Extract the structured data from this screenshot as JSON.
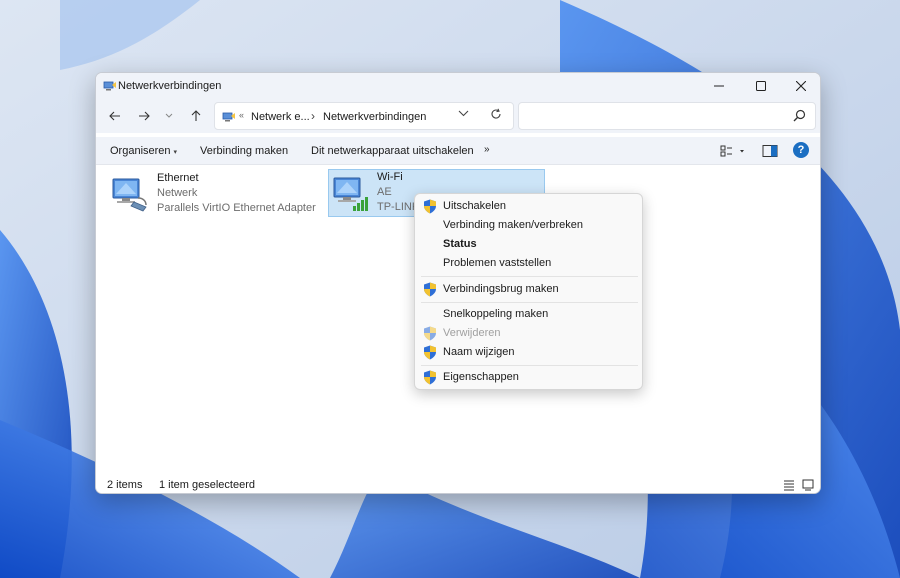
{
  "window": {
    "title": "Netwerkverbindingen"
  },
  "address_bar": {
    "crumbs": [
      "Netwerk e...",
      "Netwerkverbindingen"
    ]
  },
  "search": {
    "placeholder": ""
  },
  "command_bar": {
    "organize": "Organiseren",
    "connect": "Verbinding maken",
    "disable_device": "Dit netwerkapparaat uitschakelen",
    "more": "»"
  },
  "items": [
    {
      "name": "Ethernet",
      "status": "Netwerk",
      "adapter": "Parallels VirtIO Ethernet Adapter",
      "selected": false
    },
    {
      "name": "Wi-Fi",
      "status": "AE",
      "adapter": "TP-LINK",
      "selected": true
    }
  ],
  "status_bar": {
    "count": "2 items",
    "selection": "1 item geselecteerd"
  },
  "context_menu": {
    "items": [
      {
        "label": "Uitschakelen",
        "icon": "shield-icon",
        "bold": false,
        "disabled": false
      },
      {
        "label": "Verbinding maken/verbreken",
        "icon": "",
        "bold": false,
        "disabled": false
      },
      {
        "label": "Status",
        "icon": "",
        "bold": true,
        "disabled": false
      },
      {
        "label": "Problemen vaststellen",
        "icon": "",
        "bold": false,
        "disabled": false
      },
      {
        "label": "Verbindingsbrug maken",
        "icon": "shield-icon",
        "bold": false,
        "disabled": false
      },
      {
        "label": "Snelkoppeling maken",
        "icon": "",
        "bold": false,
        "disabled": false
      },
      {
        "label": "Verwijderen",
        "icon": "shield-icon",
        "bold": false,
        "disabled": true
      },
      {
        "label": "Naam wijzigen",
        "icon": "shield-icon",
        "bold": false,
        "disabled": false
      },
      {
        "label": "Eigenschappen",
        "icon": "shield-icon",
        "bold": false,
        "disabled": false
      }
    ]
  },
  "colors": {
    "selection_fill": "#cce4f7",
    "selection_border": "#99c9ef",
    "accent": "#1b6ec2",
    "shield_blue": "#2f6fd6",
    "shield_yellow": "#f2c230"
  }
}
